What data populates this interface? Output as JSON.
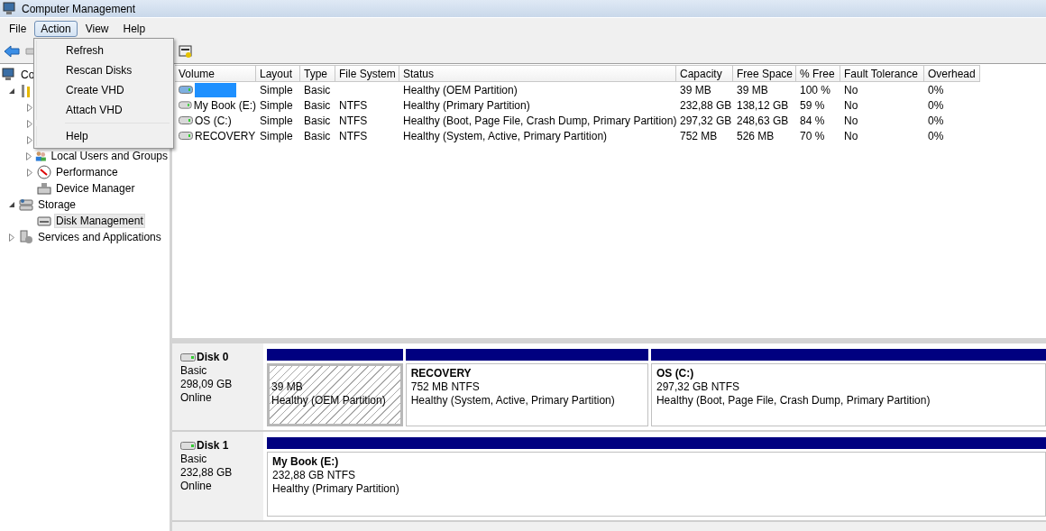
{
  "window": {
    "title": "Computer Management"
  },
  "menubar": [
    {
      "label": "File",
      "selected": false
    },
    {
      "label": "Action",
      "selected": true
    },
    {
      "label": "View",
      "selected": false
    },
    {
      "label": "Help",
      "selected": false
    }
  ],
  "action_menu": [
    {
      "label": "Refresh",
      "kind": "item"
    },
    {
      "label": "Rescan Disks",
      "kind": "item"
    },
    {
      "label": "Create VHD",
      "kind": "item"
    },
    {
      "label": "Attach VHD",
      "kind": "item"
    },
    {
      "kind": "separator"
    },
    {
      "label": "Help",
      "kind": "item"
    }
  ],
  "tree": [
    {
      "label": "Co",
      "selected": false,
      "children": [
        {
          "expanded": true,
          "children": [
            {
              "expanded": false
            },
            {
              "expanded": false
            },
            {
              "expanded": false
            },
            {
              "label": "Local Users and Groups",
              "expanded": false,
              "selected": false
            },
            {
              "label": "Performance",
              "expanded": false,
              "selected": false
            },
            {
              "label": "Device Manager",
              "selected": false
            }
          ]
        },
        {
          "label": "Storage",
          "expanded": true,
          "selected": false,
          "children": [
            {
              "label": "Disk Management",
              "selected": true
            }
          ]
        },
        {
          "label": "Services and Applications",
          "expanded": false,
          "selected": false
        }
      ]
    }
  ],
  "volumes": {
    "columns": [
      "Volume",
      "Layout",
      "Type",
      "File System",
      "Status",
      "Capacity",
      "Free Space",
      "% Free",
      "Fault Tolerance",
      "Overhead"
    ],
    "rows": [
      {
        "redacted": true,
        "cells": [
          "",
          "Simple",
          "Basic",
          "",
          "Healthy (OEM Partition)",
          "39 MB",
          "39 MB",
          "100 %",
          "No",
          "0%"
        ]
      },
      {
        "redacted": false,
        "cells": [
          "My Book (E:)",
          "Simple",
          "Basic",
          "NTFS",
          "Healthy (Primary Partition)",
          "232,88 GB",
          "138,12 GB",
          "59 %",
          "No",
          "0%"
        ]
      },
      {
        "redacted": false,
        "cells": [
          "OS (C:)",
          "Simple",
          "Basic",
          "NTFS",
          "Healthy (Boot, Page File, Crash Dump, Primary Partition)",
          "297,32 GB",
          "248,63 GB",
          "84 %",
          "No",
          "0%"
        ]
      },
      {
        "redacted": false,
        "cells": [
          "RECOVERY",
          "Simple",
          "Basic",
          "NTFS",
          "Healthy (System, Active, Primary Partition)",
          "752 MB",
          "526 MB",
          "70 %",
          "No",
          "0%"
        ]
      }
    ]
  },
  "disks": [
    {
      "name": "Disk 0",
      "type": "Basic",
      "size": "298,09 GB",
      "status": "Online",
      "partitions": [
        {
          "kind": "oem",
          "selected": true,
          "size": "39 MB",
          "status": "Healthy (OEM Partition)"
        },
        {
          "kind": "primary",
          "selected": false,
          "name": "RECOVERY",
          "size": "752 MB NTFS",
          "status": "Healthy (System, Active, Primary Partition)"
        },
        {
          "kind": "primary",
          "selected": false,
          "name": "OS  (C:)",
          "size": "297,32 GB NTFS",
          "status": "Healthy (Boot, Page File, Crash Dump, Primary Partition)"
        }
      ]
    },
    {
      "name": "Disk 1",
      "type": "Basic",
      "size": "232,88 GB",
      "status": "Online",
      "partitions": [
        {
          "kind": "primary",
          "selected": false,
          "name": "My Book  (E:)",
          "size": "232,88 GB NTFS",
          "status": "Healthy (Primary Partition)"
        }
      ]
    }
  ]
}
